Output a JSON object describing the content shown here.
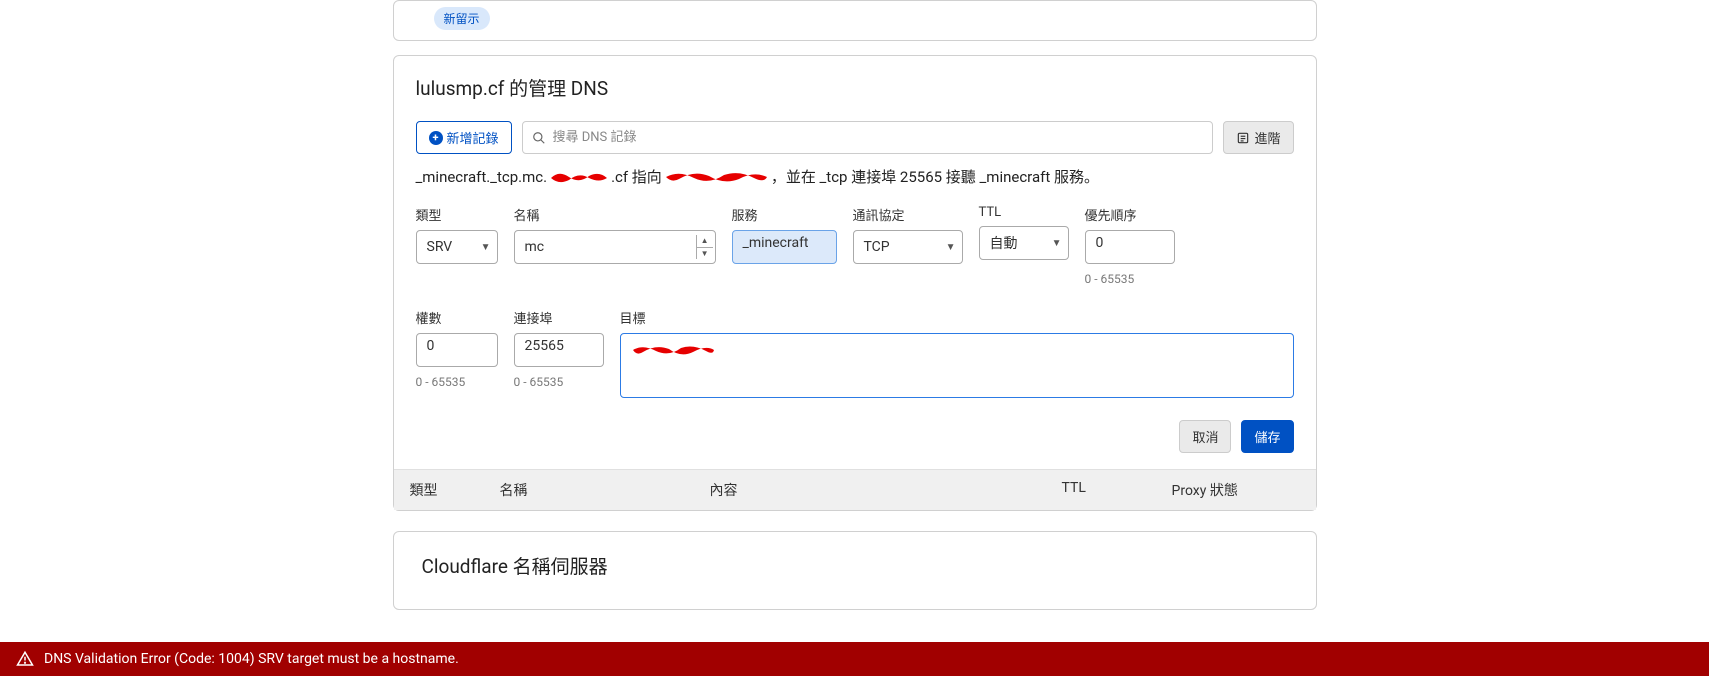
{
  "top_badge": "新留示",
  "panel": {
    "title": "lulusmp.cf 的管理 DNS",
    "add_record": "新增記錄",
    "search_placeholder": "搜尋 DNS 記錄",
    "advanced": "進階",
    "summary": {
      "p1": "_minecraft._tcp.mc.",
      "p2": ".cf 指向 ",
      "p3": "，並在 _tcp 連接埠 25565 接聽 _minecraft 服務。"
    },
    "labels": {
      "type": "類型",
      "name": "名稱",
      "service": "服務",
      "protocol": "通訊協定",
      "ttl": "TTL",
      "priority": "優先順序",
      "weight": "權數",
      "port": "連接埠",
      "target": "目標"
    },
    "values": {
      "type": "SRV",
      "name": "mc",
      "service": "_minecraft",
      "protocol": "TCP",
      "ttl": "自動",
      "priority": "0",
      "weight": "0",
      "port": "25565"
    },
    "hints": {
      "priority": "0 - 65535",
      "weight": "0 - 65535",
      "port": "0 - 65535"
    },
    "actions": {
      "cancel": "取消",
      "save": "儲存"
    },
    "table": {
      "type": "類型",
      "name": "名稱",
      "content": "內容",
      "ttl": "TTL",
      "proxy": "Proxy 狀態"
    }
  },
  "ns_panel": {
    "title": "Cloudflare 名稱伺服器"
  },
  "error": {
    "message": "DNS Validation Error (Code: 1004) SRV target must be a hostname."
  }
}
